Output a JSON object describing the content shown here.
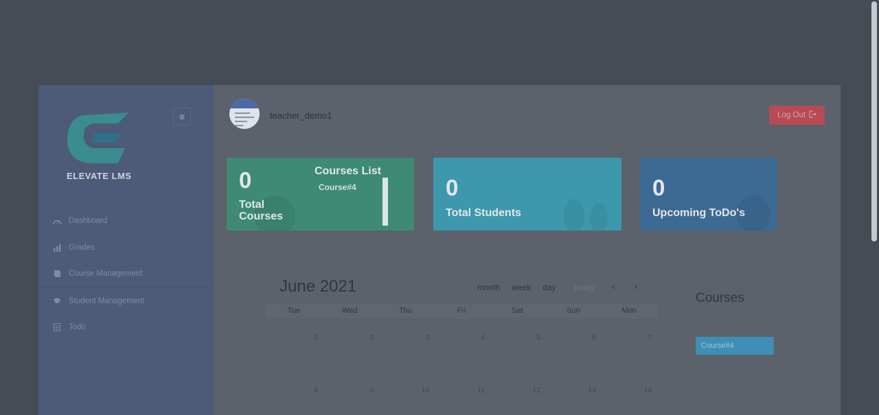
{
  "sidebar": {
    "logo_text": "ELEVATE LMS",
    "menu": [
      {
        "label": "Dashboard",
        "icon": "speedometer-icon"
      },
      {
        "label": "Grades",
        "icon": "bar-chart-icon"
      },
      {
        "label": "Course Management",
        "icon": "book-icon"
      },
      {
        "label": "Student Management",
        "icon": "graduation-cap-icon"
      },
      {
        "label": "Todo",
        "icon": "list-icon"
      }
    ]
  },
  "header": {
    "username": "teacher_demo1",
    "logout_label": "Log Out"
  },
  "cards": {
    "total_courses": {
      "value": "0",
      "label": "Total Courses",
      "list_title": "Courses List",
      "list_items": [
        "Course#4"
      ]
    },
    "total_students": {
      "value": "0",
      "label": "Total Students"
    },
    "upcoming_todos": {
      "value": "0",
      "label": "Upcoming ToDo's"
    }
  },
  "calendar": {
    "title": "June 2021",
    "views": [
      "month",
      "week",
      "day"
    ],
    "today_label": "today",
    "prev": "‹",
    "next": "›",
    "weekdays": [
      "Tue",
      "Wed",
      "Thu",
      "Fri",
      "Sat",
      "Sun",
      "Mon"
    ],
    "week1": [
      "1",
      "2",
      "3",
      "4",
      "5",
      "6",
      "7"
    ],
    "week2": [
      "8",
      "9",
      "10",
      "11",
      "12",
      "13",
      "14"
    ]
  },
  "courses_panel": {
    "title": "Courses",
    "items": [
      "Course#4"
    ]
  },
  "colors": {
    "sidebar": "#4d5a78",
    "card_green": "#3e8a74",
    "card_cyan": "#3d98ad",
    "card_blue": "#3c6a94",
    "logout": "#b84a55"
  }
}
